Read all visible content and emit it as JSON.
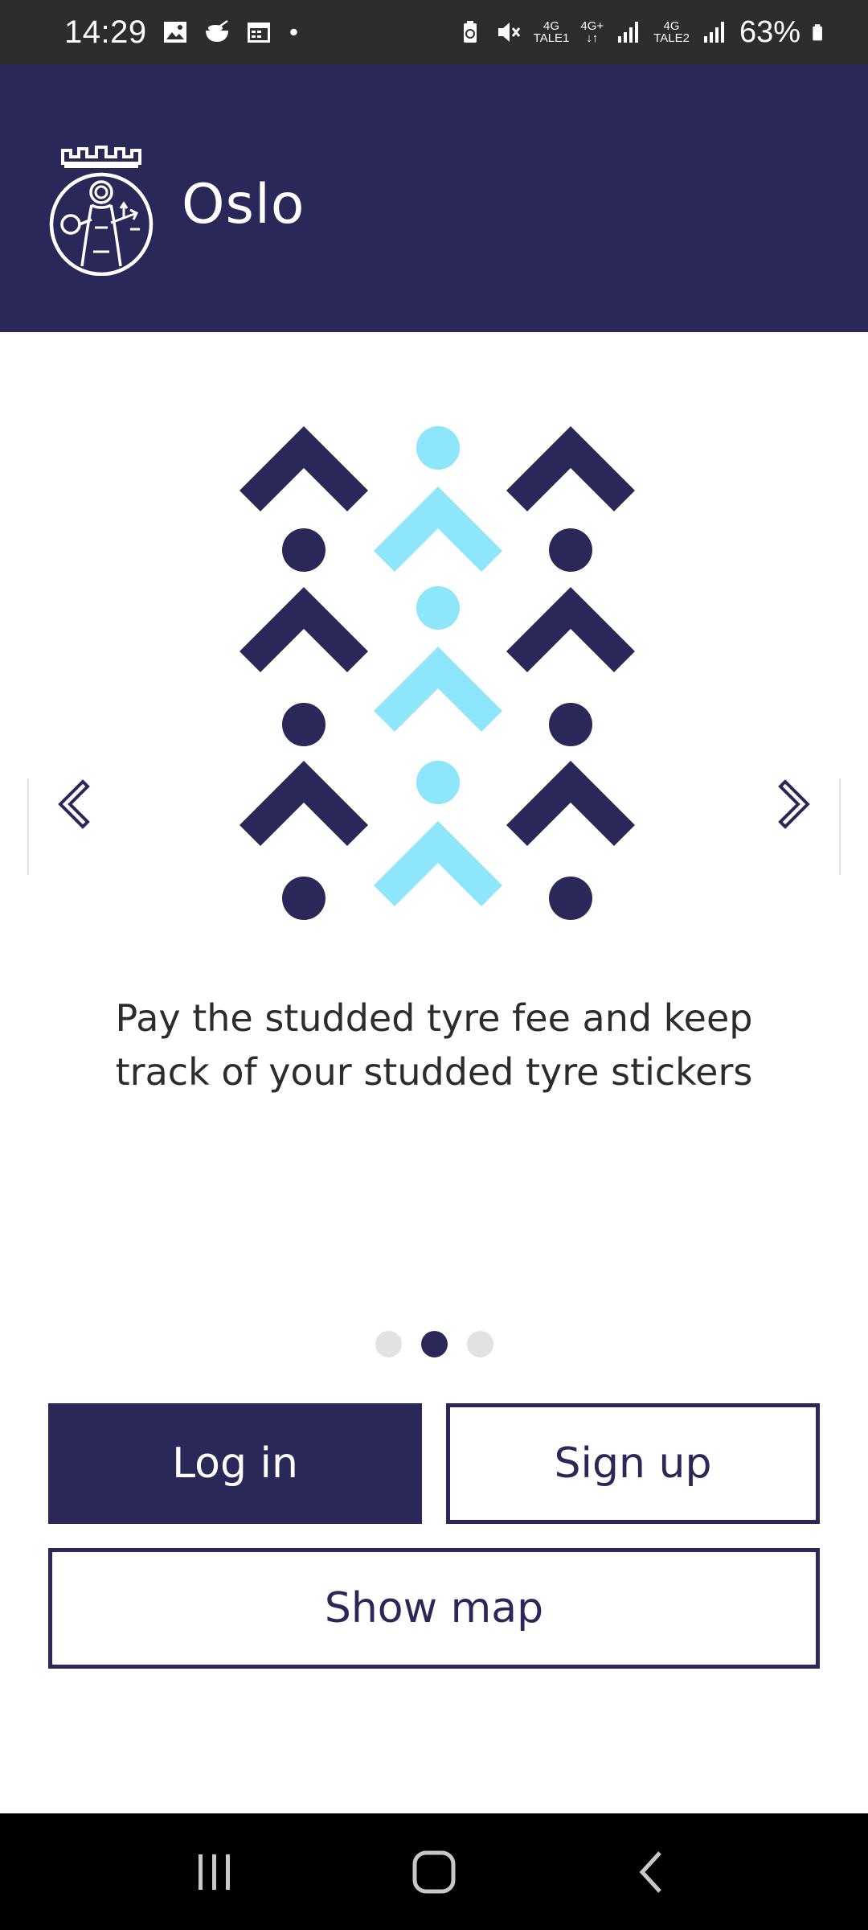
{
  "status_bar": {
    "time": "14:29",
    "network": [
      {
        "top": "4G",
        "bottom": "TALE1"
      },
      {
        "top": "4G+",
        "bottom": "↓↑"
      },
      {
        "top": "4G",
        "bottom": "TALE2"
      }
    ],
    "battery": "63%"
  },
  "header": {
    "title": "Oslo",
    "logo_icon": "oslo-city-seal-icon"
  },
  "carousel": {
    "caption": "Pay the studded tyre fee and keep track of your studded tyre stickers",
    "slide_count": 3,
    "active_slide": 2,
    "prev_icon": "chevron-left-icon",
    "next_icon": "chevron-right-icon"
  },
  "actions": {
    "login_label": "Log in",
    "signup_label": "Sign up",
    "map_label": "Show map"
  },
  "colors": {
    "brand_dark": "#2a2859",
    "brand_light": "#8ee6fa",
    "status_bar": "#2d2d2d",
    "dot_inactive": "#e2e2e2"
  }
}
